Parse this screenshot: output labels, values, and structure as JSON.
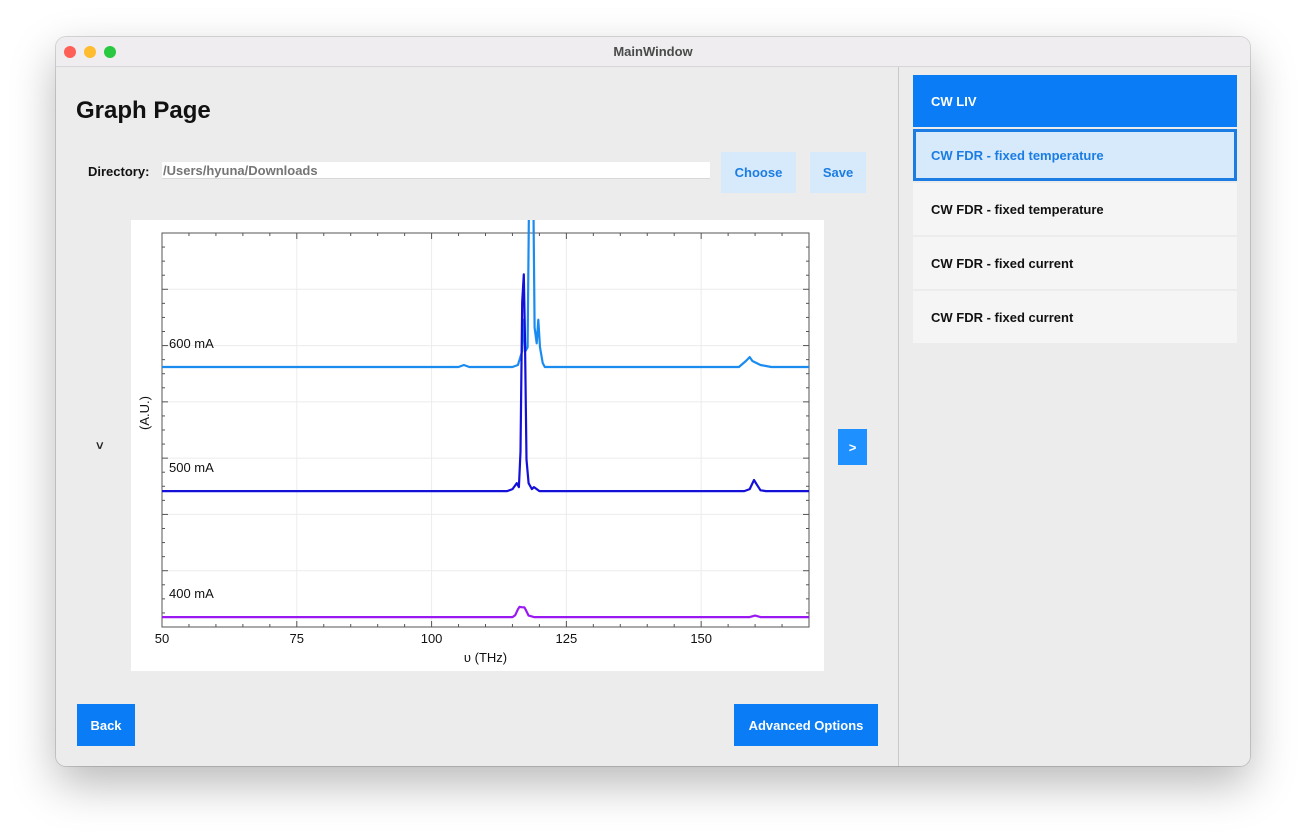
{
  "window": {
    "title": "MainWindow"
  },
  "page": {
    "title": "Graph Page",
    "directory_label": "Directory:",
    "directory_placeholder": "/Users/hyuna/Downloads",
    "choose_label": "Choose",
    "save_label": "Save",
    "nav_prev_label": ">",
    "nav_next_label": ">",
    "back_label": "Back",
    "advanced_label": "Advanced Options"
  },
  "sidebar": {
    "items": [
      {
        "label": "CW LIV",
        "state": "active"
      },
      {
        "label": "CW FDR - fixed temperature",
        "state": "selected"
      },
      {
        "label": "CW FDR - fixed temperature",
        "state": "normal"
      },
      {
        "label": "CW FDR - fixed current",
        "state": "normal"
      },
      {
        "label": "CW FDR - fixed current",
        "state": "normal"
      }
    ]
  },
  "colors": {
    "accent": "#0a7cf5",
    "accent_light": "#d6eafb",
    "series_600": "#1a8cf0",
    "series_500": "#1410d8",
    "series_400": "#9a18f2"
  },
  "chart_data": {
    "type": "line",
    "xlabel": "υ (THz)",
    "ylabel": "(A.U.)",
    "xlim": [
      50,
      170
    ],
    "x_ticks": [
      50,
      75,
      100,
      125,
      150
    ],
    "ylim": [
      0,
      1
    ],
    "grid": true,
    "series": [
      {
        "name": "600 mA",
        "offset": 0.66,
        "points": [
          [
            50,
            0
          ],
          [
            105,
            0
          ],
          [
            106,
            0.005
          ],
          [
            107,
            0
          ],
          [
            115,
            0
          ],
          [
            116,
            0.005
          ],
          [
            116.8,
            0.04
          ],
          [
            117.1,
            0.12
          ],
          [
            117.4,
            0.04
          ],
          [
            117.8,
            0.05
          ],
          [
            118.2,
            0.6
          ],
          [
            118.5,
            0.95
          ],
          [
            118.8,
            0.55
          ],
          [
            119.1,
            0.1
          ],
          [
            119.5,
            0.06
          ],
          [
            119.8,
            0.12
          ],
          [
            120.1,
            0.05
          ],
          [
            120.6,
            0.01
          ],
          [
            121,
            0
          ],
          [
            157,
            0
          ],
          [
            158.3,
            0.015
          ],
          [
            159,
            0.025
          ],
          [
            159.5,
            0.015
          ],
          [
            161,
            0.005
          ],
          [
            163,
            0
          ],
          [
            170,
            0
          ]
        ]
      },
      {
        "name": "500 mA",
        "offset": 0.345,
        "points": [
          [
            50,
            0
          ],
          [
            114,
            0
          ],
          [
            115,
            0.005
          ],
          [
            115.8,
            0.02
          ],
          [
            116.2,
            0.01
          ],
          [
            116.5,
            0.1
          ],
          [
            116.8,
            0.48
          ],
          [
            117.1,
            0.55
          ],
          [
            117.3,
            0.4
          ],
          [
            117.6,
            0.08
          ],
          [
            118,
            0.02
          ],
          [
            118.6,
            0.005
          ],
          [
            119,
            0.01
          ],
          [
            120,
            0
          ],
          [
            158,
            0
          ],
          [
            159,
            0.005
          ],
          [
            159.8,
            0.028
          ],
          [
            160.4,
            0.015
          ],
          [
            161,
            0.002
          ],
          [
            162,
            0
          ],
          [
            170,
            0
          ]
        ]
      },
      {
        "name": "400 mA",
        "offset": 0.025,
        "points": [
          [
            50,
            0
          ],
          [
            115,
            0
          ],
          [
            115.5,
            0.005
          ],
          [
            116,
            0.02
          ],
          [
            116.3,
            0.026
          ],
          [
            116.8,
            0.025
          ],
          [
            117.2,
            0.025
          ],
          [
            117.5,
            0.018
          ],
          [
            118,
            0.004
          ],
          [
            119,
            0
          ],
          [
            159,
            0
          ],
          [
            160,
            0.004
          ],
          [
            161,
            0
          ],
          [
            170,
            0
          ]
        ]
      }
    ]
  }
}
